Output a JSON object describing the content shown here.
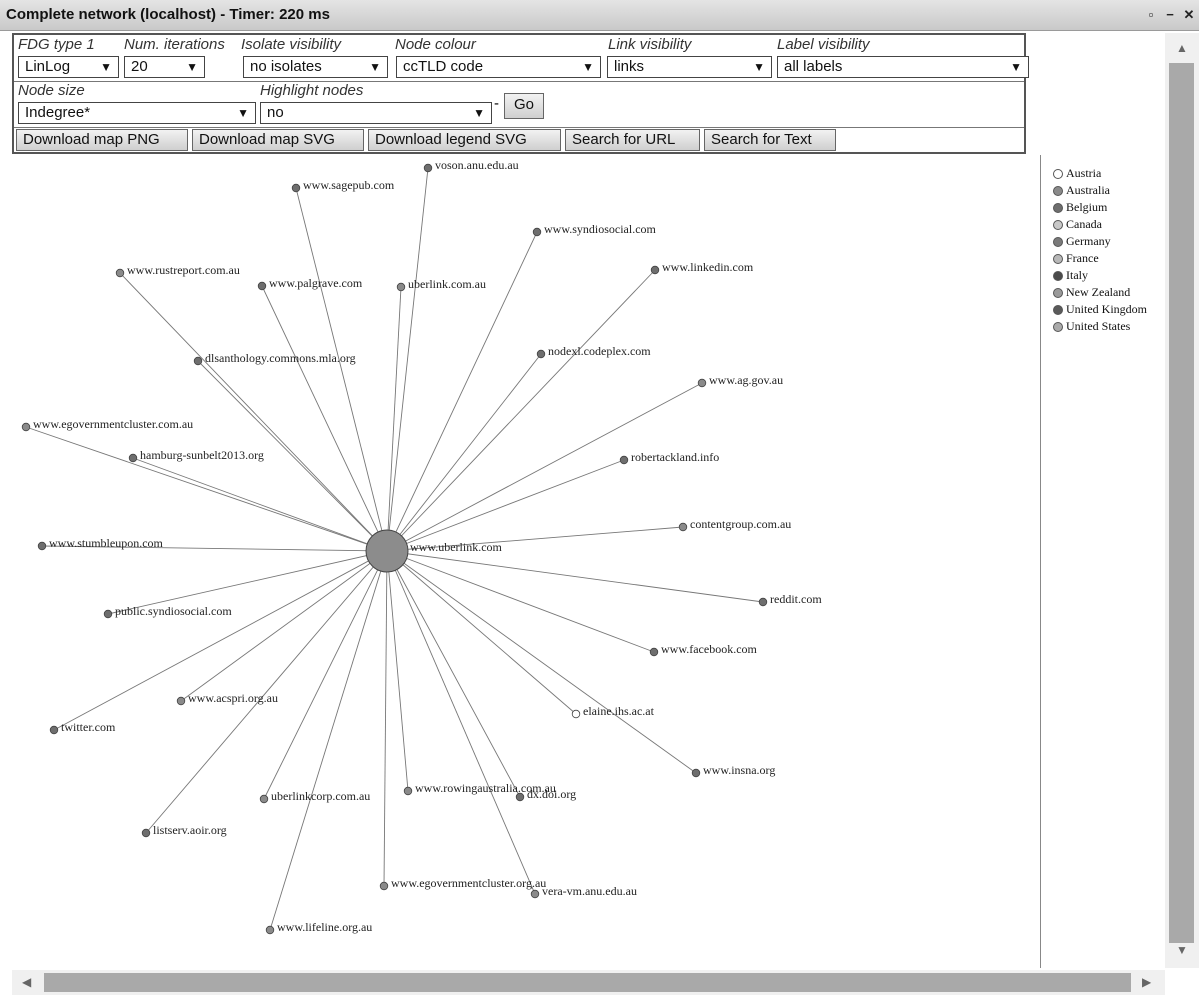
{
  "window": {
    "title": "Complete network (localhost) - Timer: 220 ms",
    "buttons": [
      "▫",
      "−",
      "✕"
    ]
  },
  "controls": {
    "fdg_type": {
      "label": "FDG type 1",
      "value": "LinLog"
    },
    "iterations": {
      "label": "Num. iterations",
      "value": "20"
    },
    "isolate": {
      "label": "Isolate visibility",
      "value": "no isolates"
    },
    "node_colour": {
      "label": "Node colour",
      "value": "ccTLD code"
    },
    "link_vis": {
      "label": "Link visibility",
      "value": "links"
    },
    "label_vis": {
      "label": "Label visibility",
      "value": "all labels"
    },
    "node_size": {
      "label": "Node size",
      "value": "Indegree*"
    },
    "highlight": {
      "label": "Highlight nodes",
      "value": "no"
    },
    "go": "Go",
    "buttons": [
      "Download map PNG",
      "Download map SVG",
      "Download legend SVG",
      "Search for URL",
      "Search for Text"
    ]
  },
  "network": {
    "center": {
      "label": "www.uberlink.com"
    },
    "nodes": [
      {
        "label": "voson.anu.edu.au",
        "color": "#6e6e6e"
      },
      {
        "label": "www.sagepub.com",
        "color": "#6e6e6e"
      },
      {
        "label": "www.syndiosocial.com",
        "color": "#6e6e6e"
      },
      {
        "label": "www.rustreport.com.au",
        "color": "#8a8a8a"
      },
      {
        "label": "www.palgrave.com",
        "color": "#6e6e6e"
      },
      {
        "label": "uberlink.com.au",
        "color": "#8a8a8a"
      },
      {
        "label": "www.linkedin.com",
        "color": "#6e6e6e"
      },
      {
        "label": "dlsanthology.commons.mla.org",
        "color": "#6e6e6e"
      },
      {
        "label": "nodexl.codeplex.com",
        "color": "#6e6e6e"
      },
      {
        "label": "www.ag.gov.au",
        "color": "#8a8a8a"
      },
      {
        "label": "www.egovernmentcluster.com.au",
        "color": "#8a8a8a"
      },
      {
        "label": "hamburg-sunbelt2013.org",
        "color": "#6e6e6e"
      },
      {
        "label": "robertackland.info",
        "color": "#6e6e6e"
      },
      {
        "label": "contentgroup.com.au",
        "color": "#8a8a8a"
      },
      {
        "label": "www.stumbleupon.com",
        "color": "#6e6e6e"
      },
      {
        "label": "reddit.com",
        "color": "#6e6e6e"
      },
      {
        "label": "public.syndiosocial.com",
        "color": "#6e6e6e"
      },
      {
        "label": "www.facebook.com",
        "color": "#6e6e6e"
      },
      {
        "label": "www.acspri.org.au",
        "color": "#8a8a8a"
      },
      {
        "label": "elaine.ihs.ac.at",
        "color": "#ffffff"
      },
      {
        "label": "twitter.com",
        "color": "#6e6e6e"
      },
      {
        "label": "www.insna.org",
        "color": "#6e6e6e"
      },
      {
        "label": "uberlinkcorp.com.au",
        "color": "#8a8a8a"
      },
      {
        "label": "www.rowingaustralia.com.au",
        "color": "#8a8a8a"
      },
      {
        "label": "dx.doi.org",
        "color": "#6e6e6e"
      },
      {
        "label": "listserv.aoir.org",
        "color": "#6e6e6e"
      },
      {
        "label": "www.egovernmentcluster.org.au",
        "color": "#8a8a8a"
      },
      {
        "label": "vera-vm.anu.edu.au",
        "color": "#8a8a8a"
      },
      {
        "label": "www.lifeline.org.au",
        "color": "#8a8a8a"
      }
    ]
  },
  "legend": [
    {
      "label": "Austria",
      "color": "#ffffff"
    },
    {
      "label": "Australia",
      "color": "#8a8a8a"
    },
    {
      "label": "Belgium",
      "color": "#6e6e6e"
    },
    {
      "label": "Canada",
      "color": "#c8c8c8"
    },
    {
      "label": "Germany",
      "color": "#7a7a7a"
    },
    {
      "label": "France",
      "color": "#b8b8b8"
    },
    {
      "label": "Italy",
      "color": "#4a4a4a"
    },
    {
      "label": "New Zealand",
      "color": "#9a9a9a"
    },
    {
      "label": "United Kingdom",
      "color": "#5a5a5a"
    },
    {
      "label": "United States",
      "color": "#aaaaaa"
    }
  ]
}
